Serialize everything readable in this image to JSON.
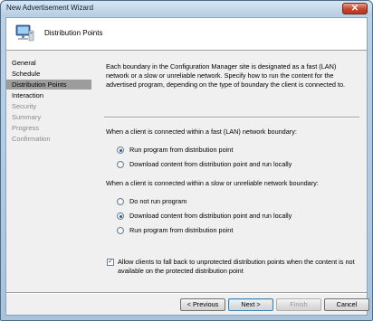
{
  "window": {
    "title": "New Advertisement Wizard",
    "close_glyph": "✕"
  },
  "header": {
    "title": "Distribution Points",
    "icon": "computer-icon"
  },
  "nav": {
    "items": [
      {
        "label": "General",
        "state": "normal"
      },
      {
        "label": "Schedule",
        "state": "normal"
      },
      {
        "label": "Distribution Points",
        "state": "selected"
      },
      {
        "label": "Interaction",
        "state": "normal"
      },
      {
        "label": "Security",
        "state": "disabled"
      },
      {
        "label": "Summary",
        "state": "disabled"
      },
      {
        "label": "Progress",
        "state": "disabled"
      },
      {
        "label": "Confirmation",
        "state": "disabled"
      }
    ]
  },
  "content": {
    "description": "Each boundary in the Configuration Manager site is designated as a fast (LAN) network or a slow or unreliable network. Specify how to run the content for the advertised program, depending on the type of boundary the client is connected to.",
    "fast_group": {
      "label": "When a client is connected within a fast (LAN) network boundary:",
      "options": [
        {
          "label": "Run program from distribution point",
          "selected": true
        },
        {
          "label": "Download content from distribution point and run locally",
          "selected": false
        }
      ]
    },
    "slow_group": {
      "label": "When a client is connected within a slow or unreliable network boundary:",
      "options": [
        {
          "label": "Do not run program",
          "selected": false
        },
        {
          "label": "Download content from distribution point and run locally",
          "selected": true
        },
        {
          "label": "Run program from distribution point",
          "selected": false
        }
      ]
    },
    "fallback": {
      "label": "Allow clients to fall back to unprotected distribution points when the content is not available on the protected distribution point",
      "checked": true,
      "check_glyph": "✓"
    }
  },
  "buttons": {
    "previous": "< Previous",
    "next": "Next >",
    "finish": "Finish",
    "cancel": "Cancel"
  },
  "colors": {
    "selected_nav_bg": "#9c9c9c",
    "title_bar": "#b7cde2",
    "close_button": "#c7432a"
  }
}
